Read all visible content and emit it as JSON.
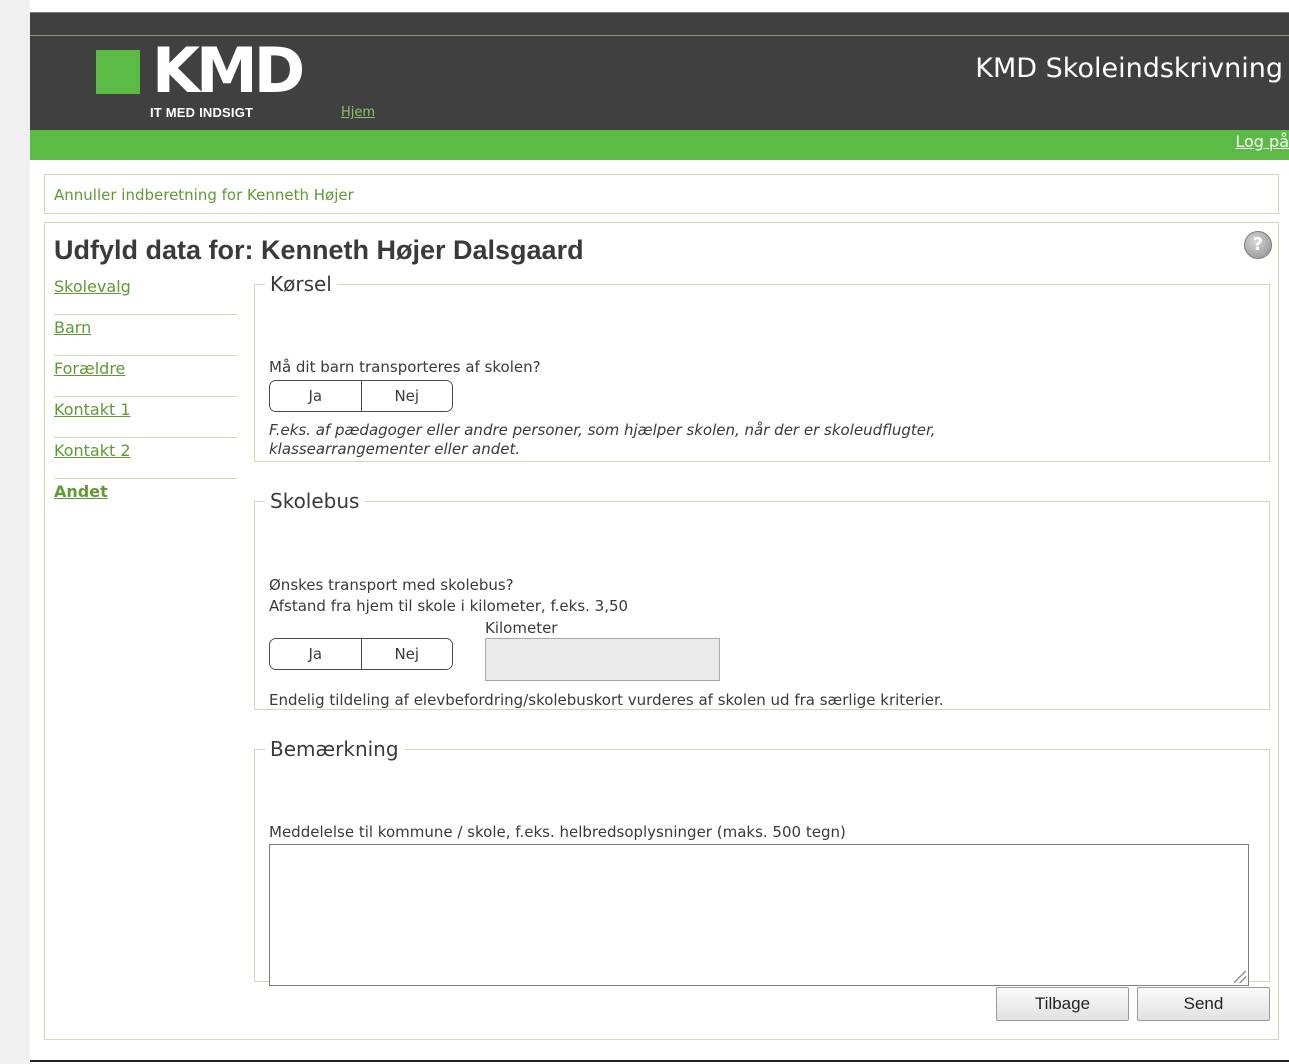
{
  "header": {
    "logo_text": "KMD",
    "logo_tagline": "IT MED INDSIGT",
    "home_link": "Hjem",
    "app_title": "KMD Skoleindskrivning",
    "login_link": "Log på"
  },
  "colors": {
    "brand_green": "#5bbb46",
    "header_dark": "#404040",
    "link_green": "#5f9a36"
  },
  "cancel_bar": {
    "text": "Annuller indberetning for Kenneth Højer"
  },
  "page": {
    "title": "Udfyld data for: Kenneth Højer Dalsgaard",
    "help_icon": "help-icon"
  },
  "sidebar": {
    "items": [
      {
        "label": "Skolevalg"
      },
      {
        "label": "Barn"
      },
      {
        "label": "Forældre"
      },
      {
        "label": "Kontakt 1"
      },
      {
        "label": "Kontakt 2"
      },
      {
        "label": "Andet"
      }
    ],
    "active": "Andet"
  },
  "korsel": {
    "legend": "Kørsel",
    "question": "Må dit barn transporteres af skolen?",
    "yes": "Ja",
    "no": "Nej",
    "note_line1": "F.eks. af pædagoger eller andre personer, som hjælper skolen, når der er skoleudflugter,",
    "note_line2": "klassearrangementer eller andet."
  },
  "skolebus": {
    "legend": "Skolebus",
    "question": "Ønskes transport med skolebus?",
    "distance_text": "Afstand fra hjem til skole i kilometer, f.eks. 3,50",
    "km_label": "Kilometer",
    "km_value": "",
    "yes": "Ja",
    "no": "Nej",
    "note": "Endelig tildeling af elevbefordring/skolebuskort vurderes af skolen ud fra særlige kriterier."
  },
  "bemaerkning": {
    "legend": "Bemærkning",
    "label": "Meddelelse til kommune / skole, f.eks. helbredsoplysninger (maks. 500 tegn)",
    "value": ""
  },
  "buttons": {
    "back": "Tilbage",
    "send": "Send"
  }
}
